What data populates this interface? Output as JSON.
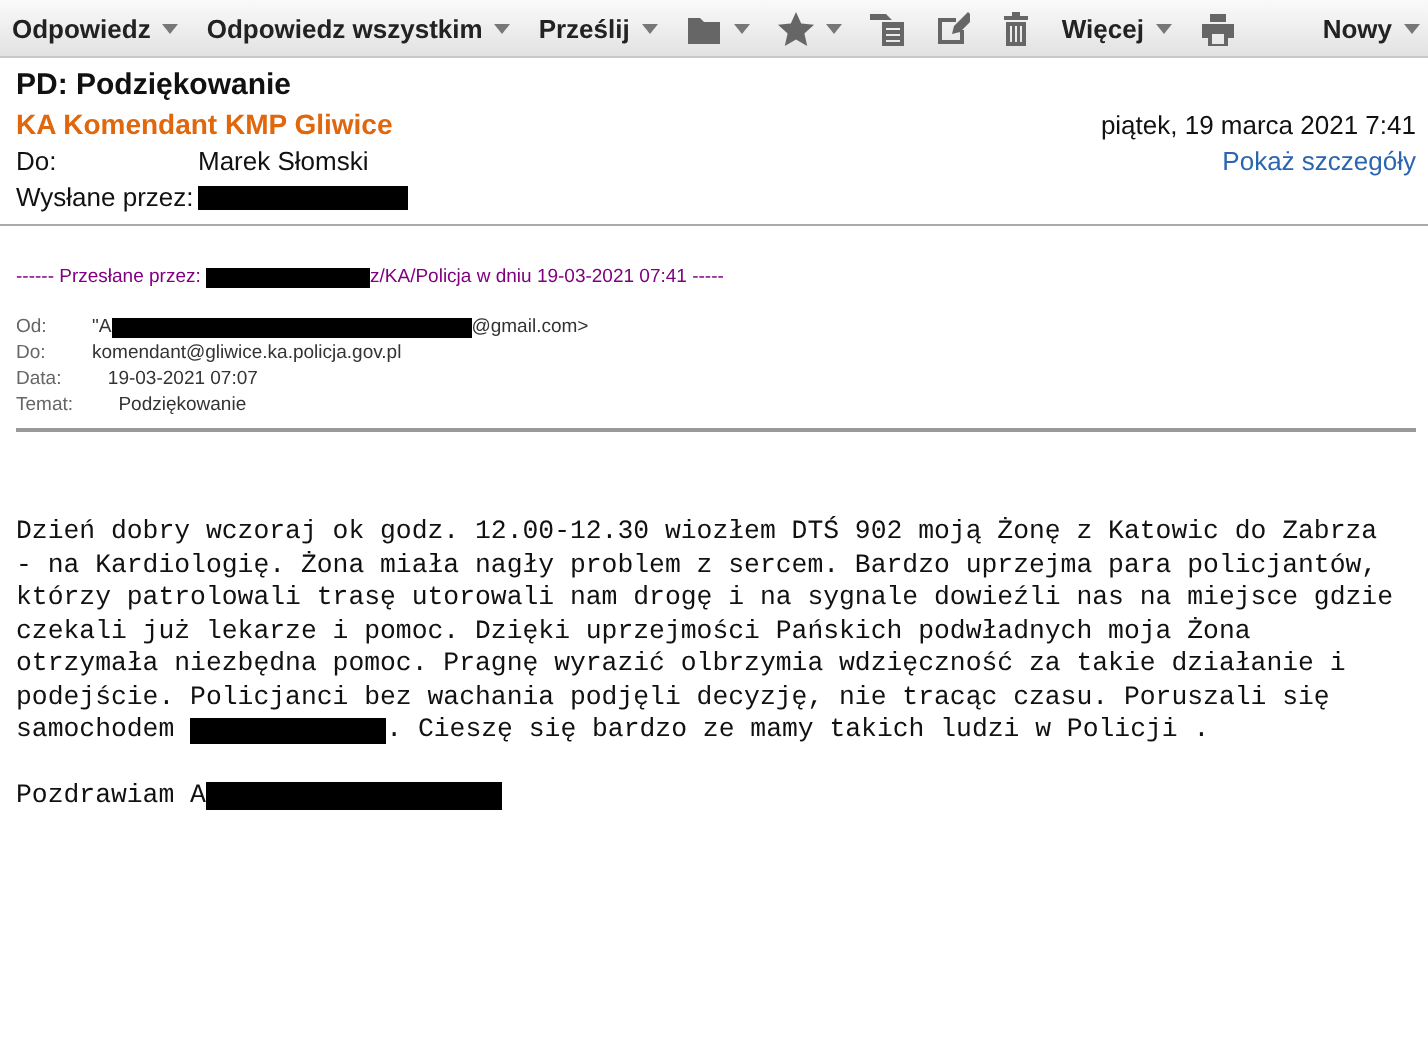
{
  "toolbar": {
    "items": [
      {
        "kind": "menu",
        "label": "Odpowiedz"
      },
      {
        "kind": "menu",
        "label": "Odpowiedz wszystkim"
      },
      {
        "kind": "menu",
        "label": "Prześlij"
      },
      {
        "kind": "icon-menu"
      },
      {
        "kind": "icon-menu"
      },
      {
        "kind": "icon"
      },
      {
        "kind": "icon"
      },
      {
        "kind": "icon"
      },
      {
        "kind": "menu",
        "label": "Więcej"
      },
      {
        "kind": "icon"
      }
    ],
    "right": {
      "label": "Nowy"
    }
  },
  "message": {
    "subject": "PD: Podziękowanie",
    "sender": "KA Komendant KMP Gliwice",
    "date": "piątek, 19 marca 2021 7:41",
    "to_label": "Do:",
    "to": "Marek Słomski",
    "sent_by_label": "Wysłane przez:",
    "details_link": "Pokaż szczegóły"
  },
  "forward": {
    "before": "------ Przesłane przez: ",
    "after": "z/KA/Policja w dniu 19-03-2021 07:41 -----",
    "fields": [
      {
        "label": "Od:",
        "before": "\"A",
        "after": "@gmail.com>"
      },
      {
        "label": "Do:",
        "before": "komendant@gliwice.ka.policja.gov.pl"
      },
      {
        "label": "Data:",
        "before": "   19-03-2021 07:07"
      },
      {
        "label": "Temat:",
        "before": "     Podziękowanie"
      }
    ]
  },
  "body": {
    "lines": [
      "Dzień dobry wczoraj ok godz. 12.00-12.30 wiozłem DTŚ 902 moją Żonę z Katowic do Zabrza",
      "- na Kardiologię. Żona miała nagły problem z sercem. Bardzo uprzejma para policjantów,",
      "którzy patrolowali trasę utorowali nam drogę i na sygnale dowieźli nas na miejsce gdzie",
      "czekali już lekarze i pomoc. Dzięki uprzejmości Pańskich podwładnych moja Żona",
      "otrzymała niezbędna pomoc. Pragnę wyrazić olbrzymia wdzięczność za takie działanie i",
      "podejście. Policjanci bez wachania podjęli decyzję, nie tracąc czasu. Poruszali się"
    ],
    "before": "samochodem",
    "after": ". Cieszę się bardzo ze mamy takich ludzi w Policji .",
    "signature": "Pozdrawiam A"
  }
}
